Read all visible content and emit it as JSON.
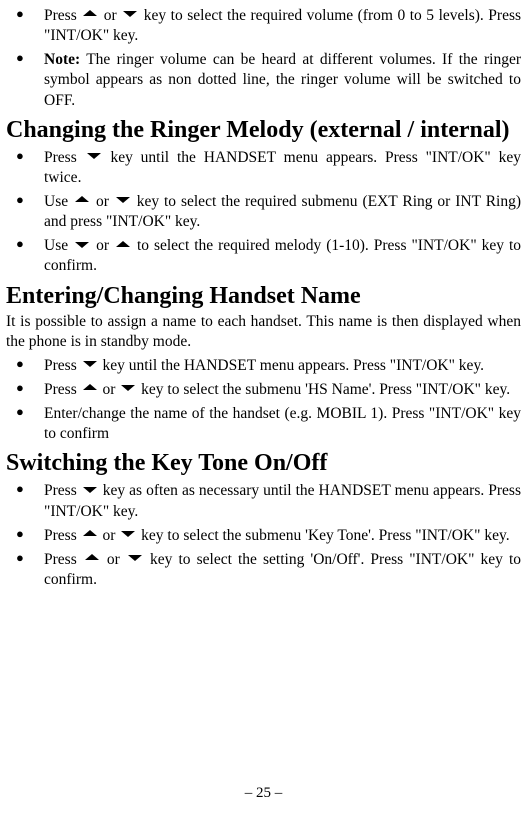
{
  "sec0": {
    "b1_a": "Press ",
    "b1_b": " or ",
    "b1_c": " key to select the required volume (from 0 to 5 levels). Press \"INT/OK\" key.",
    "b2_label": "Note:",
    "b2_text": " The ringer volume can be heard at different volumes. If the ringer symbol appears as non dotted line, the ringer volume will be switched to OFF."
  },
  "sec1": {
    "heading": "Changing the Ringer Melody (external / internal)",
    "b1_a": "Press ",
    "b1_b": " key until the HANDSET menu appears. Press \"INT/OK\" key twice.",
    "b2_a": "Use ",
    "b2_b": " or ",
    "b2_c": " key to select the required submenu (EXT Ring or INT Ring) and press \"INT/OK\" key.",
    "b3_a": "Use ",
    "b3_b": " or ",
    "b3_c": " to select the required melody (1-10). Press \"INT/OK\" key to confirm."
  },
  "sec2": {
    "heading": "Entering/Changing Handset Name",
    "intro": "It is possible to assign a name to each handset. This name is then displayed when the phone is in standby mode.",
    "b1_a": "Press ",
    "b1_b": " key until the HANDSET menu appears. Press \"INT/OK\" key.",
    "b2_a": "Press ",
    "b2_b": " or ",
    "b2_c": " key to select the submenu 'HS Name'. Press \"INT/OK\" key.",
    "b3": "Enter/change the name of the handset (e.g. MOBIL 1). Press \"INT/OK\" key to confirm"
  },
  "sec3": {
    "heading": "Switching the Key Tone On/Off",
    "b1_a": "Press ",
    "b1_b": " key as often as necessary until the HANDSET menu appears. Press \"INT/OK\" key.",
    "b2_a": "Press ",
    "b2_b": " or ",
    "b2_c": " key to select the submenu 'Key Tone'. Press \"INT/OK\" key.",
    "b3_a": "Press ",
    "b3_b": " or ",
    "b3_c": " key to select the setting 'On/Off'. Press \"INT/OK\" key to confirm."
  },
  "page_number": "– 25 –"
}
